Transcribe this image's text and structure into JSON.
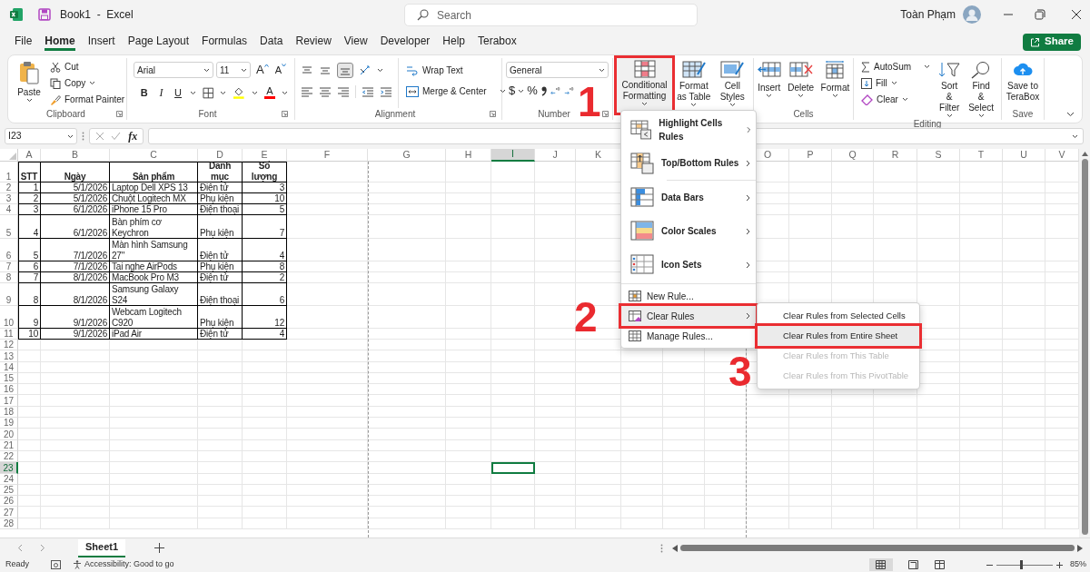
{
  "title_bar": {
    "title": "Book1  -  Excel",
    "search_placeholder": "Search",
    "user_name": "Toàn Phạm"
  },
  "menu_tabs": [
    {
      "label": "File",
      "selected": false
    },
    {
      "label": "Home",
      "selected": true
    },
    {
      "label": "Insert",
      "selected": false
    },
    {
      "label": "Page Layout",
      "selected": false
    },
    {
      "label": "Formulas",
      "selected": false
    },
    {
      "label": "Data",
      "selected": false
    },
    {
      "label": "Review",
      "selected": false
    },
    {
      "label": "View",
      "selected": false
    },
    {
      "label": "Developer",
      "selected": false
    },
    {
      "label": "Help",
      "selected": false
    },
    {
      "label": "Terabox",
      "selected": false
    }
  ],
  "share_button": "Share",
  "ribbon": {
    "clipboard": {
      "paste": "Paste",
      "cut": "Cut",
      "copy": "Copy",
      "format_painter": "Format Painter",
      "label": "Clipboard"
    },
    "font": {
      "font_name": "Arial",
      "font_size": "11",
      "grow_font": "A",
      "shrink_font": "A",
      "bold": "B",
      "italic": "I",
      "underline": "U",
      "font_color": "A",
      "label": "Font"
    },
    "alignment": {
      "wrap_text": "Wrap Text",
      "merge_center": "Merge & Center",
      "label": "Alignment"
    },
    "number": {
      "format": "General",
      "currency": "$",
      "percent": "%",
      "label": "Number"
    },
    "styles": {
      "conditional_formatting": {
        "label": "Conditional Formatting",
        "highlighted": true
      },
      "format_as_table": "Format as Table",
      "cell_styles": "Cell Styles"
    },
    "cells": {
      "insert": "Insert",
      "delete": "Delete",
      "format": "Format",
      "label": "Cells"
    },
    "editing": {
      "autosum": "AutoSum",
      "fill": "Fill",
      "clear": "Clear",
      "sort_filter": "Sort & Filter",
      "find_select": "Find & Select",
      "label": "Editing"
    },
    "save": {
      "save_to_terabox": "Save to TeraBox",
      "label": "Save"
    }
  },
  "formula_bar": {
    "name_box": "I23",
    "function_button": "fx"
  },
  "sheet": {
    "column_headers": [
      {
        "label": "A",
        "selected": false
      },
      {
        "label": "B",
        "selected": false
      },
      {
        "label": "C",
        "selected": false
      },
      {
        "label": "D",
        "selected": false
      },
      {
        "label": "E",
        "selected": false
      },
      {
        "label": "F",
        "selected": false
      },
      {
        "label": "G",
        "selected": false
      },
      {
        "label": "H",
        "selected": false
      },
      {
        "label": "I",
        "selected": true
      },
      {
        "label": "J",
        "selected": false
      },
      {
        "label": "K",
        "selected": false
      },
      {
        "label": "O",
        "selected": false
      },
      {
        "label": "P",
        "selected": false
      },
      {
        "label": "Q",
        "selected": false
      },
      {
        "label": "R",
        "selected": false
      },
      {
        "label": "S",
        "selected": false
      },
      {
        "label": "T",
        "selected": false
      },
      {
        "label": "U",
        "selected": false
      },
      {
        "label": "V",
        "selected": false
      }
    ],
    "row_headers": [
      {
        "label": "1",
        "selected": false
      },
      {
        "label": "2",
        "selected": false
      },
      {
        "label": "3",
        "selected": false
      },
      {
        "label": "4",
        "selected": false
      },
      {
        "label": "5",
        "selected": false
      },
      {
        "label": "6",
        "selected": false
      },
      {
        "label": "7",
        "selected": false
      },
      {
        "label": "8",
        "selected": false
      },
      {
        "label": "9",
        "selected": false
      },
      {
        "label": "10",
        "selected": false
      },
      {
        "label": "11",
        "selected": false
      },
      {
        "label": "12",
        "selected": false
      },
      {
        "label": "13",
        "selected": false
      },
      {
        "label": "14",
        "selected": false
      },
      {
        "label": "15",
        "selected": false
      },
      {
        "label": "16",
        "selected": false
      },
      {
        "label": "17",
        "selected": false
      },
      {
        "label": "18",
        "selected": false
      },
      {
        "label": "19",
        "selected": false
      },
      {
        "label": "20",
        "selected": false
      },
      {
        "label": "21",
        "selected": false
      },
      {
        "label": "22",
        "selected": false
      },
      {
        "label": "23",
        "selected": true
      },
      {
        "label": "24",
        "selected": false
      },
      {
        "label": "25",
        "selected": false
      },
      {
        "label": "26",
        "selected": false
      },
      {
        "label": "27",
        "selected": false
      },
      {
        "label": "28",
        "selected": false
      }
    ],
    "header_row": [
      "STT",
      "Ngày",
      "Sản phẩm",
      "Danh mục",
      "Số lượng"
    ],
    "rows": [
      [
        "1",
        "5/1/2026",
        "Laptop Dell XPS 13",
        "Điện tử",
        "3"
      ],
      [
        "2",
        "5/1/2026",
        "Chuột Logitech MX",
        "Phụ kiện",
        "10"
      ],
      [
        "3",
        "6/1/2026",
        "iPhone 15 Pro",
        "Điện thoại",
        "5"
      ],
      [
        "4",
        "6/1/2026",
        "Bàn phím cơ Keychron",
        "Phụ kiện",
        "7"
      ],
      [
        "5",
        "7/1/2026",
        "Màn hình Samsung 27\"",
        "Điện tử",
        "4"
      ],
      [
        "6",
        "7/1/2026",
        "Tai nghe AirPods",
        "Phụ kiện",
        "8"
      ],
      [
        "7",
        "8/1/2026",
        "MacBook Pro M3",
        "Điện tử",
        "2"
      ],
      [
        "8",
        "8/1/2026",
        "Samsung Galaxy S24",
        "Điện thoại",
        "6"
      ],
      [
        "9",
        "9/1/2026",
        "Webcam Logitech C920",
        "Phụ kiện",
        "12"
      ],
      [
        "10",
        "9/1/2026",
        "iPad Air",
        "Điện tử",
        "4"
      ]
    ]
  },
  "conditional_formatting_menu": [
    {
      "kind": "large",
      "label": "Highlight Cells Rules",
      "submenu": true,
      "selected": false,
      "highlighted": false
    },
    {
      "kind": "large",
      "label": "Top/Bottom Rules",
      "submenu": true,
      "selected": false,
      "highlighted": false
    },
    {
      "kind": "large",
      "label": "Data Bars",
      "submenu": true,
      "selected": false,
      "highlighted": false
    },
    {
      "kind": "large",
      "label": "Color Scales",
      "submenu": true,
      "selected": false,
      "highlighted": false
    },
    {
      "kind": "large",
      "label": "Icon Sets",
      "submenu": true,
      "selected": false,
      "highlighted": false
    },
    {
      "kind": "small",
      "label": "New Rule...",
      "submenu": false,
      "selected": false,
      "highlighted": false
    },
    {
      "kind": "small",
      "label": "Clear Rules",
      "submenu": true,
      "selected": true,
      "highlighted": true
    },
    {
      "kind": "small",
      "label": "Manage Rules...",
      "submenu": false,
      "selected": false,
      "highlighted": false
    }
  ],
  "clear_rules_submenu": [
    {
      "label": "Clear Rules from Selected Cells",
      "disabled": false,
      "selected": false,
      "highlighted": false
    },
    {
      "label": "Clear Rules from Entire Sheet",
      "disabled": false,
      "selected": true,
      "highlighted": true
    },
    {
      "label": "Clear Rules from This Table",
      "disabled": true,
      "selected": false,
      "highlighted": false
    },
    {
      "label": "Clear Rules from This PivotTable",
      "disabled": true,
      "selected": false,
      "highlighted": false
    }
  ],
  "annotations": [
    "1",
    "2",
    "3"
  ],
  "sheet_tabs": [
    {
      "label": "Sheet1",
      "selected": true
    }
  ],
  "status_bar": {
    "mode": "Ready",
    "accessibility": "Accessibility: Good to go",
    "zoom": "85%",
    "zoom_slider": {
      "level": 0.45
    }
  }
}
